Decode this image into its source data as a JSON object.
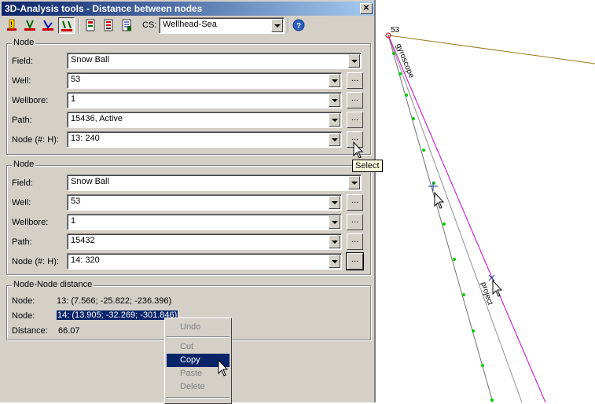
{
  "window": {
    "title": "3D-Analysis tools - Distance between nodes",
    "close_glyph": "✕"
  },
  "toolbar": {
    "cs_label": "CS:",
    "cs_value": "Wellhead-Sea",
    "buttons": [
      "warning-icon",
      "well-tool-icon",
      "path-tool-icon",
      "node-distance-icon",
      "export-icon",
      "report-icon",
      "report-list-icon",
      "help-icon"
    ]
  },
  "node1": {
    "legend": "Node",
    "field_label": "Field:",
    "field_value": "Snow Ball",
    "well_label": "Well:",
    "well_value": "53",
    "wellbore_label": "Wellbore:",
    "wellbore_value": "1",
    "path_label": "Path:",
    "path_value": "15436, Active",
    "node_label": "Node (#: H):",
    "node_value": "13: 240",
    "browse": "..."
  },
  "node2": {
    "legend": "Node",
    "field_label": "Field:",
    "field_value": "Snow Ball",
    "well_label": "Well:",
    "well_value": "53",
    "wellbore_label": "Wellbore:",
    "wellbore_value": "1",
    "path_label": "Path:",
    "path_value": "15432",
    "node_label": "Node (#: H):",
    "node_value": "14: 320",
    "browse": "..."
  },
  "distance": {
    "legend": "Node-Node distance",
    "node1_label": "Node:",
    "node1_value": "13: (7.566; -25.822; -236.396)",
    "node2_label": "Node:",
    "node2_value": "14: (13.905; -32.269; -301.846)",
    "dist_label": "Distance:",
    "dist_value": "66.07"
  },
  "tooltip": "Select",
  "context_menu": {
    "undo": "Undo",
    "cut": "Cut",
    "copy": "Copy",
    "paste": "Paste",
    "delete": "Delete"
  },
  "viewport": {
    "well_label": "53",
    "gyro_label": "gyroscope",
    "project_label": "project"
  },
  "colors": {
    "title_start": "#0a246a",
    "title_end": "#a6caf0",
    "path_active": "#808080",
    "path_project": "#cc00cc",
    "nodes": "#00cc00",
    "seabed": "#9a7a20"
  }
}
